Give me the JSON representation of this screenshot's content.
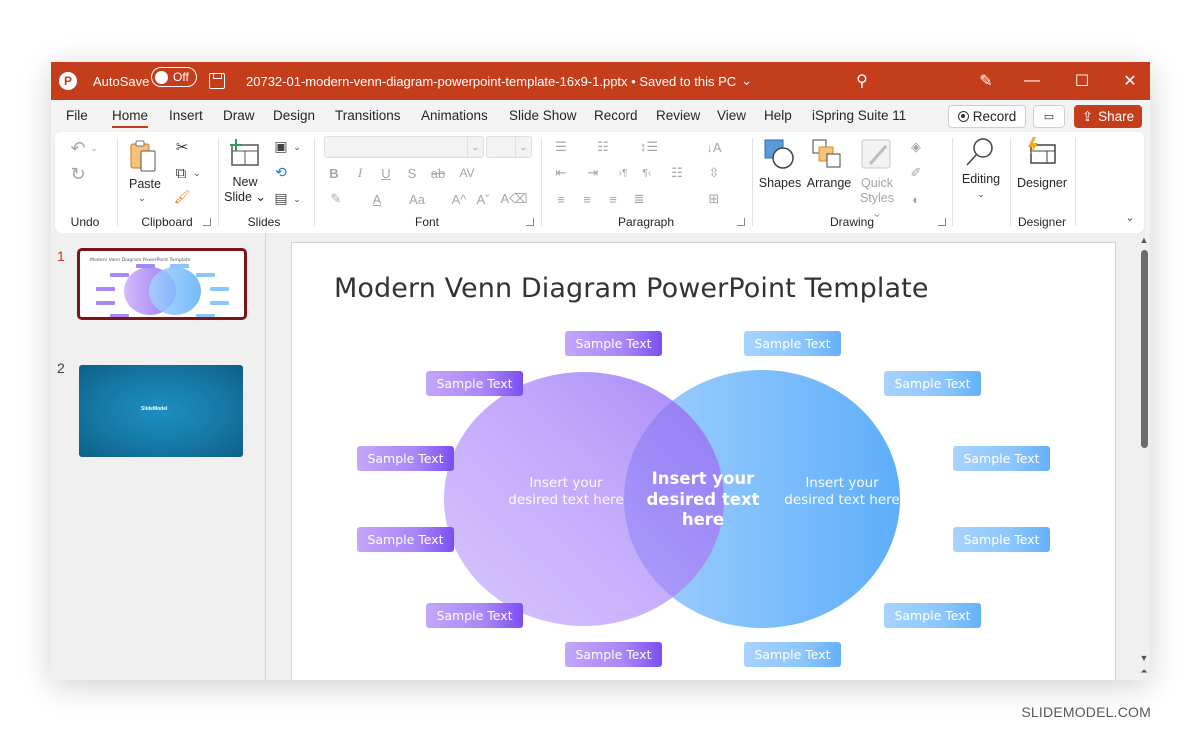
{
  "titlebar": {
    "app_logo": "P",
    "autosave_label": "AutoSave",
    "autosave_state": "Off",
    "doc_title": "20732-01-modern-venn-diagram-powerpoint-template-16x9-1.pptx • Saved to this PC",
    "doc_title_chevron": "⌄",
    "icons": {
      "search": "⚲",
      "designer_pen": "✎",
      "minimize": "—",
      "maximize": "☐",
      "close": "✕"
    }
  },
  "menu": {
    "tabs": [
      "File",
      "Home",
      "Insert",
      "Draw",
      "Design",
      "Transitions",
      "Animations",
      "Slide Show",
      "Record",
      "Review",
      "View",
      "Help",
      "iSpring Suite 11"
    ],
    "active_tab": "Home",
    "record_button": "Record",
    "comment_icon": "▭",
    "share_button": "Share",
    "share_icon": "⇪"
  },
  "ribbon": {
    "groups": {
      "undo": "Undo",
      "clipboard": "Clipboard",
      "slides": "Slides",
      "font": "Font",
      "paragraph": "Paragraph",
      "drawing": "Drawing",
      "designer": "Designer"
    },
    "buttons": {
      "undo_icon": "↶",
      "redo_icon": "↻",
      "paste": "Paste",
      "cut_icon": "✂",
      "copy_icon": "⧉",
      "format_painter_icon": "🖌",
      "new_slide_line1": "New",
      "new_slide_line2": "Slide ⌄",
      "layout_icon": "▣",
      "reset_icon": "⟲",
      "section_icon": "▤",
      "bold": "B",
      "italic": "I",
      "underline": "U",
      "shadow": "S",
      "strike": "ab",
      "spacing": "AV",
      "highlight_icon": "✎",
      "font_color": "A",
      "change_case": "Aa",
      "grow_font": "A^",
      "shrink_font": "Aˇ",
      "clear_format": "A⌫",
      "bullets_icon": "☰",
      "numbering_icon": "☷",
      "line_spacing_icon": "↕☰",
      "text_direction_icon": "↓A",
      "decrease_indent_icon": "⇤",
      "increase_indent_icon": "⇥",
      "ltr_icon": "›¶",
      "rtl_icon": "¶‹",
      "columns_icon": "☷",
      "align_text_icon": "⇳",
      "align_left_icon": "≡",
      "align_center_icon": "≡",
      "align_right_icon": "≡",
      "justify_icon": "≣",
      "smartart_icon": "⊞",
      "shapes": "Shapes",
      "arrange": "Arrange",
      "quick_styles_line1": "Quick",
      "quick_styles_line2": "Styles ⌄",
      "shape_fill_icon": "◈",
      "shape_outline_icon": "✐",
      "shape_effects_icon": "◐",
      "editing": "Editing",
      "designer": "Designer",
      "collapse_icon": "⌄",
      "dropdown": "⌄"
    }
  },
  "slides_panel": {
    "slides": [
      {
        "number": "1",
        "active": true,
        "thumb_title": "Modern Venn Diagram PowerPoint Template"
      },
      {
        "number": "2",
        "active": false,
        "thumb_logo": "SlideModel"
      }
    ]
  },
  "slide": {
    "title": "Modern Venn Diagram PowerPoint Template",
    "left_text": "Insert your desired text here",
    "center_text": "Insert your desired text here",
    "right_text": "Insert your desired text here",
    "left_chips": [
      "Sample Text",
      "Sample Text",
      "Sample Text",
      "Sample Text",
      "Sample Text",
      "Sample Text"
    ],
    "right_chips": [
      "Sample Text",
      "Sample Text",
      "Sample Text",
      "Sample Text",
      "Sample Text",
      "Sample Text"
    ],
    "colors": {
      "purple_dark": "#7b4ef0",
      "purple_light": "#c3a6fb",
      "blue_dark": "#64b1fa",
      "blue_light": "#a7d3fd"
    }
  },
  "scrollbar": {
    "up_icon": "▲",
    "down_icon": "▼",
    "next_icon": "⏶"
  },
  "watermark": "SLIDEMODEL.COM"
}
